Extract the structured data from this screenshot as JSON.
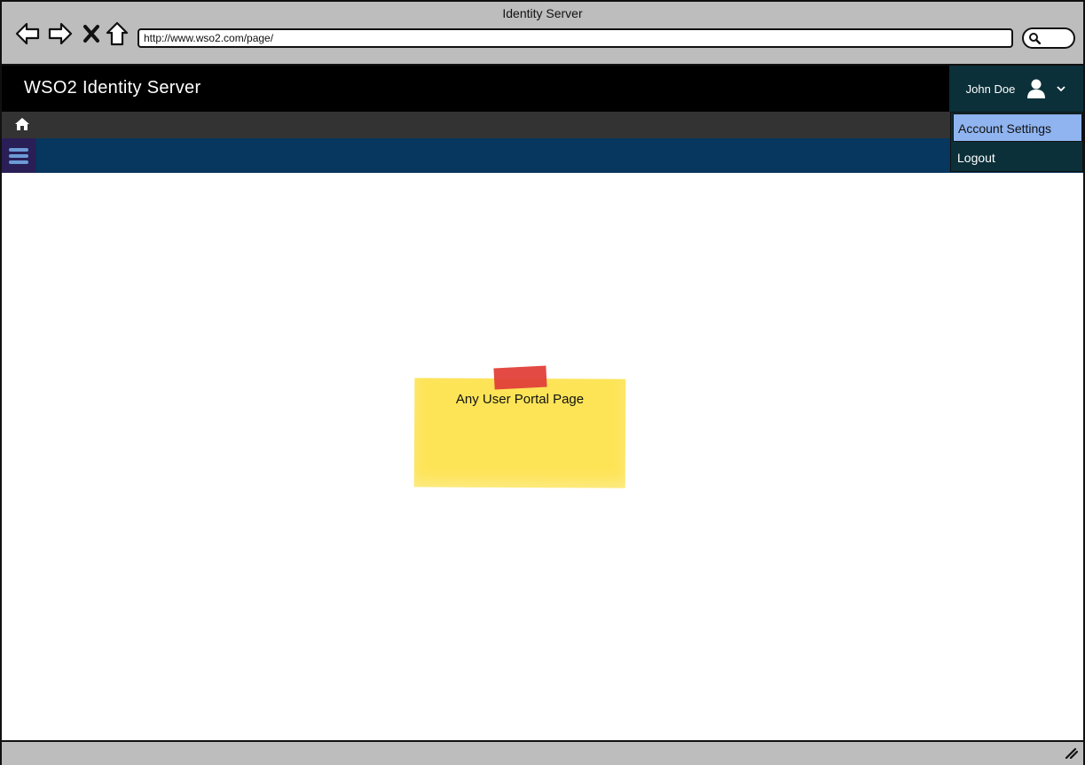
{
  "browser": {
    "window_title": "Identity Server",
    "url": "http://www.wso2.com/page/",
    "icons": [
      "back-arrow-icon",
      "forward-arrow-icon",
      "stop-icon",
      "home-icon",
      "search-icon"
    ]
  },
  "header": {
    "app_title": "WSO2 Identity Server",
    "user_name": "John Doe",
    "icons": [
      "user-icon",
      "chevron-down-icon"
    ]
  },
  "toolbar": {
    "icons": [
      "home-icon",
      "hamburger-menu-icon"
    ]
  },
  "user_menu": {
    "items": [
      {
        "label": "Account Settings",
        "active": true
      },
      {
        "label": "Logout",
        "active": false
      }
    ]
  },
  "main": {
    "note_text": "Any User Portal Page"
  },
  "colors": {
    "header_bg": "#000000",
    "user_box_bg": "#0b3039",
    "breadcrumb_bg": "#333333",
    "blue_bar_bg": "#07365e",
    "menu_button_bg": "#2a1e56",
    "active_item_bg": "#8fb4ef",
    "note_bg": "#fde457",
    "tape": "#e2403a"
  }
}
